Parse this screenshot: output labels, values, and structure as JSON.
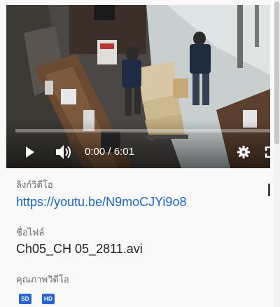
{
  "player": {
    "current_time": "0:00",
    "separator": " / ",
    "duration": "6:01",
    "progress": 0
  },
  "info": {
    "video_link_label": "ลิงก์วิดีโอ",
    "video_link": "https://youtu.be/N9moCJYi9o8",
    "file_name_label": "ชื่อไฟล์",
    "file_name": "Ch05_CH 05_2811.avi",
    "quality_label": "คุณภาพวิดีโอ",
    "quality_badges": [
      "SD",
      "HD"
    ]
  },
  "colors": {
    "link": "#1a66c9",
    "badge": "#2a64d0"
  },
  "icons": [
    "play-icon",
    "volume-icon",
    "settings-gear-icon",
    "fullscreen-icon"
  ]
}
